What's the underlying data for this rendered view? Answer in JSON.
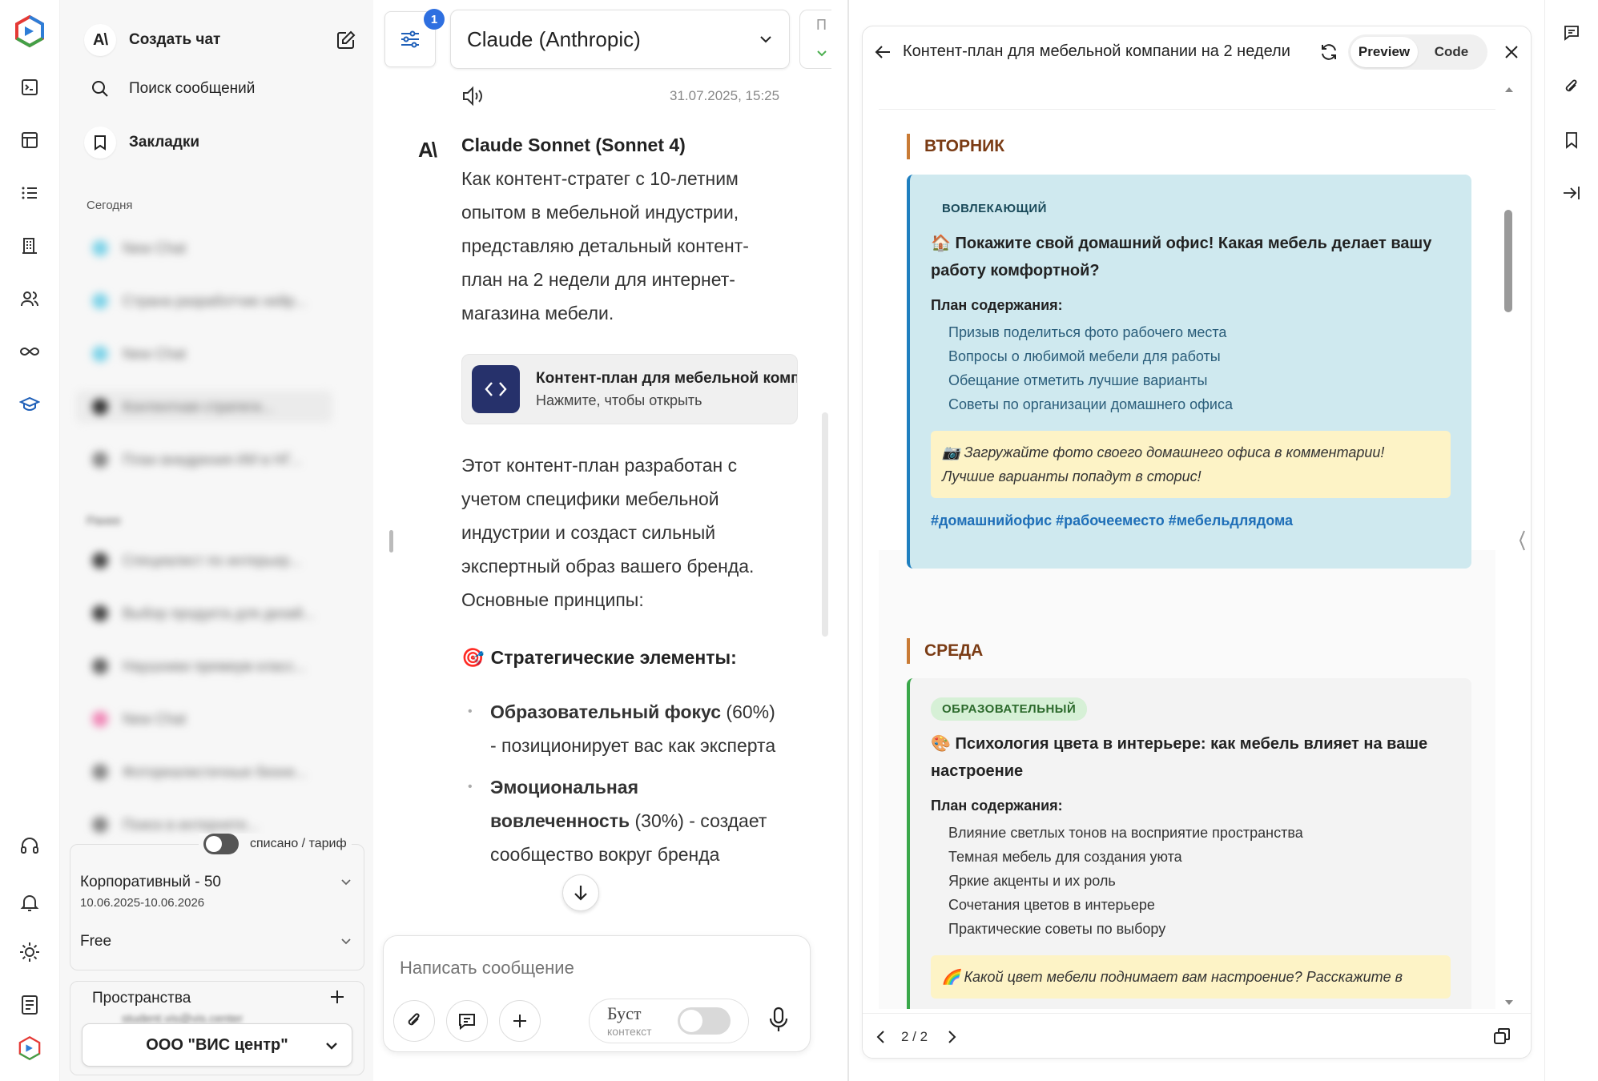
{
  "sidebar": {
    "new_chat": "Создать чат",
    "search": "Поиск сообщений",
    "bookmarks": "Закладки",
    "section_today": "Сегодня",
    "history_today": [
      {
        "label": "New Chat",
        "color": "#7fd3e8"
      },
      {
        "label": "Страна разработчик нейр...",
        "color": "#7fd3e8"
      },
      {
        "label": "New Chat",
        "color": "#7fd3e8"
      },
      {
        "label": "Контентная стратеги...",
        "color": "#333333"
      },
      {
        "label": "План внедрения ИИ в НГ...",
        "color": "#888888"
      }
    ],
    "section_earlier": "Ранее",
    "history_earlier": [
      {
        "label": "Специалист по интерьер...",
        "color": "#444444"
      },
      {
        "label": "Выбор продукта для дизай...",
        "color": "#444444"
      },
      {
        "label": "Наушники премиум класс...",
        "color": "#666666"
      },
      {
        "label": "New Chat",
        "color": "#f08ab8"
      },
      {
        "label": "Фотореалистичные бизне...",
        "color": "#888888"
      },
      {
        "label": "Поиск в интернете...",
        "color": "#888888"
      }
    ],
    "toggle_label": "списано / тариф",
    "plan_name": "Корпоративный - 50",
    "plan_dates": "10.06.2025-10.06.2026",
    "plan_free": "Free",
    "spaces_title": "Пространства",
    "spaces_sub": "student.vis@vis.center",
    "org": "ООО \"ВИС центр\""
  },
  "chat": {
    "filter_badge": "1",
    "model": "Claude (Anthropic)",
    "extra_tab": "П",
    "timestamp": "31.07.2025, 15:25",
    "bot_name": "Claude Sonnet (Sonnet 4)",
    "intro": "Как контент-стратег с 10-летним опытом в мебельной индустрии, представляю детальный контент-план на 2 недели для интернет-магазина мебели.",
    "artifact_title": "Контент-план для мебельной компании на 2 недели",
    "artifact_sub": "Нажмите, чтобы открыть",
    "para2": "Этот контент-план разработан с учетом специфики мебельной индустрии и создаст сильный экспертный образ вашего бренда. Основные принципы:",
    "section_emoji": "🎯",
    "section_title": "Стратегические элементы:",
    "bullets": [
      {
        "bold": "Образовательный фокус",
        "rest": " (60%) - позиционирует вас как эксперта"
      },
      {
        "bold": "Эмоциональная вовлеченность",
        "rest": " (30%) - создает сообщество вокруг бренда"
      }
    ],
    "input_placeholder": "Написать сообщение",
    "boost_label": "Буст",
    "boost_sub": "контекст"
  },
  "artifact": {
    "title": "Контент-план для мебельной компании на 2 недели",
    "tab_preview": "Preview",
    "tab_code": "Code",
    "pager": "2 / 2",
    "days": [
      {
        "name": "ВТОРНИК",
        "tag": "ВОВЛЕКАЮЩИЙ",
        "emoji": "🏠",
        "heading": "Покажите свой домашний офис! Какая мебель делает вашу работу комфортной?",
        "plan_label": "План содержания:",
        "items": [
          "Призыв поделиться фото рабочего места",
          "Вопросы о любимой мебели для работы",
          "Обещание отметить лучшие варианты",
          "Советы по организации домашнего офиса"
        ],
        "note_emoji": "📷",
        "note": "Загружайте фото своего домашнего офиса в комментарии! Лучшие варианты попадут в сторис!",
        "hashtags": "#домашнийофис #рабочееместо #мебельдлядома",
        "card_color": "#cfe9ef",
        "accent": "#1f7fbf"
      },
      {
        "name": "СРЕДА",
        "tag": "ОБРАЗОВАТЕЛЬНЫЙ",
        "emoji": "🎨",
        "heading": "Психология цвета в интерьере: как мебель влияет на ваше настроение",
        "plan_label": "План содержания:",
        "items": [
          "Влияние светлых тонов на восприятие пространства",
          "Темная мебель для создания уюта",
          "Яркие акценты и их роль",
          "Сочетания цветов в интерьере",
          "Практические советы по выбору"
        ],
        "note_emoji": "🌈",
        "note": "Какой цвет мебели поднимает вам настроение? Расскажите в",
        "card_color": "#f3f3f3",
        "accent": "#3aa84a"
      }
    ]
  }
}
